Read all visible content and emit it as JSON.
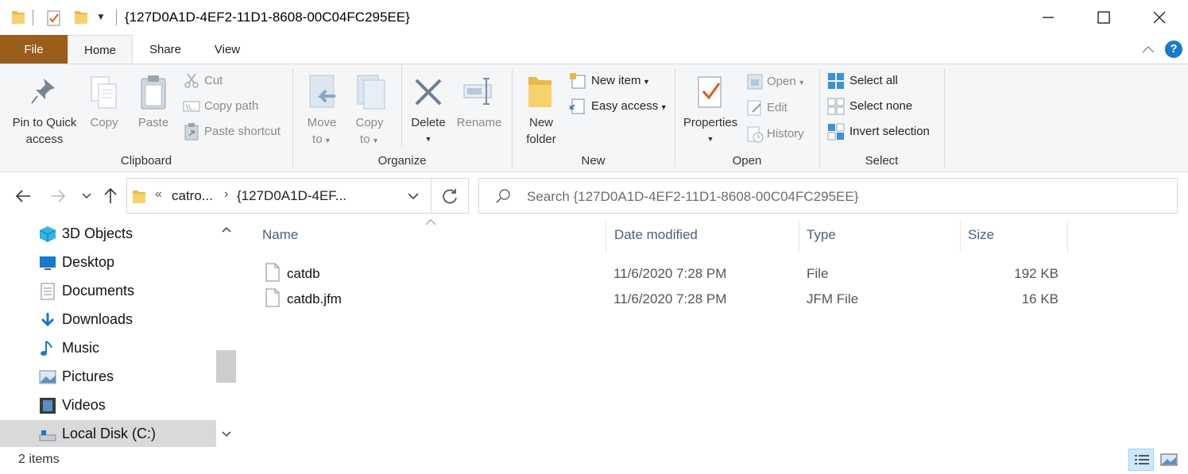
{
  "window": {
    "title": "{127D0A1D-4EF2-11D1-8608-00C04FC295EE}"
  },
  "tabs": [
    {
      "label": "File"
    },
    {
      "label": "Home"
    },
    {
      "label": "Share"
    },
    {
      "label": "View"
    }
  ],
  "ribbon": {
    "clipboard": {
      "label": "Clipboard",
      "pin_line1": "Pin to Quick",
      "pin_line2": "access",
      "copy": "Copy",
      "paste": "Paste",
      "cut": "Cut",
      "copy_path": "Copy path",
      "paste_shortcut": "Paste shortcut"
    },
    "organize": {
      "label": "Organize",
      "move_line1": "Move",
      "move_line2": "to",
      "copy_line1": "Copy",
      "copy_line2": "to",
      "delete": "Delete",
      "rename": "Rename"
    },
    "new": {
      "label": "New",
      "new_folder_line1": "New",
      "new_folder_line2": "folder",
      "new_item": "New item",
      "easy_access": "Easy access"
    },
    "open": {
      "label": "Open",
      "properties": "Properties",
      "open": "Open",
      "edit": "Edit",
      "history": "History"
    },
    "select": {
      "label": "Select",
      "select_all": "Select all",
      "select_none": "Select none",
      "invert": "Invert selection"
    }
  },
  "address": {
    "overflow": "«",
    "crumb1": "catro...",
    "crumb2": "{127D0A1D-4EF...",
    "search_placeholder": "Search {127D0A1D-4EF2-11D1-8608-00C04FC295EE}"
  },
  "nav": {
    "items": [
      {
        "label": "3D Objects",
        "icon": "3d-objects-icon"
      },
      {
        "label": "Desktop",
        "icon": "desktop-icon"
      },
      {
        "label": "Documents",
        "icon": "documents-icon"
      },
      {
        "label": "Downloads",
        "icon": "downloads-icon"
      },
      {
        "label": "Music",
        "icon": "music-icon"
      },
      {
        "label": "Pictures",
        "icon": "pictures-icon"
      },
      {
        "label": "Videos",
        "icon": "videos-icon"
      },
      {
        "label": "Local Disk (C:)",
        "icon": "local-disk-icon"
      }
    ]
  },
  "filelist": {
    "columns": [
      "Name",
      "Date modified",
      "Type",
      "Size"
    ],
    "rows": [
      {
        "name": "catdb",
        "date": "11/6/2020 7:28 PM",
        "type": "File",
        "size": "192 KB"
      },
      {
        "name": "catdb.jfm",
        "date": "11/6/2020 7:28 PM",
        "type": "JFM File",
        "size": "16 KB"
      }
    ]
  },
  "status": {
    "count": "2 items"
  },
  "colors": {
    "file_tab": "#9a5d1b",
    "ribbon_bg": "#f5f6f7",
    "accent": "#1979ca",
    "selected_nav": "#cce8ff"
  }
}
